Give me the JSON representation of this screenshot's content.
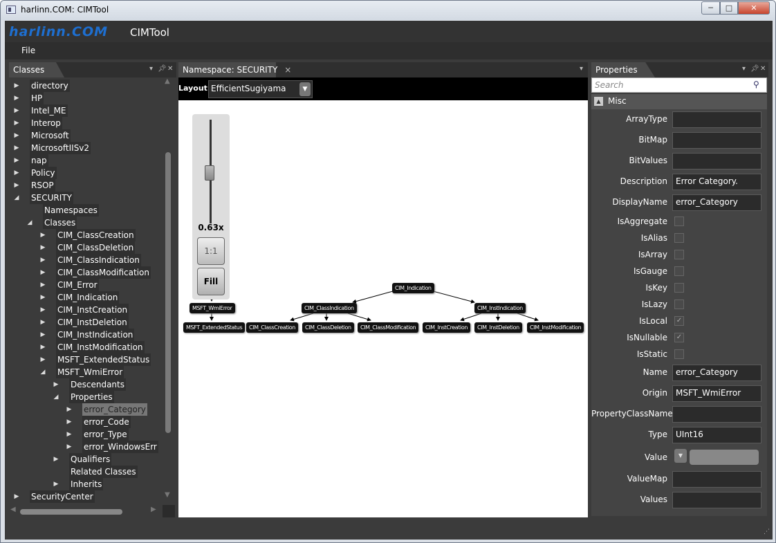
{
  "window": {
    "title": "harlinn.COM: CIMTool",
    "minimize": "─",
    "maximize": "□",
    "close": "✕"
  },
  "app": {
    "logo": "harlinn.COM",
    "title": "CIMTool"
  },
  "menu": {
    "file": "File"
  },
  "classes_panel": {
    "tab": "Classes",
    "tree": [
      {
        "label": "directory",
        "level": 1,
        "arrow": "right"
      },
      {
        "label": "HP",
        "level": 1,
        "arrow": "right"
      },
      {
        "label": "Intel_ME",
        "level": 1,
        "arrow": "right"
      },
      {
        "label": "Interop",
        "level": 1,
        "arrow": "right"
      },
      {
        "label": "Microsoft",
        "level": 1,
        "arrow": "right"
      },
      {
        "label": "MicrosoftIISv2",
        "level": 1,
        "arrow": "right"
      },
      {
        "label": "nap",
        "level": 1,
        "arrow": "right"
      },
      {
        "label": "Policy",
        "level": 1,
        "arrow": "right"
      },
      {
        "label": "RSOP",
        "level": 1,
        "arrow": "right"
      },
      {
        "label": "SECURITY",
        "level": 1,
        "arrow": "down"
      },
      {
        "label": "Namespaces",
        "level": 2,
        "arrow": ""
      },
      {
        "label": "Classes",
        "level": 2,
        "arrow": "down"
      },
      {
        "label": "CIM_ClassCreation",
        "level": 3,
        "arrow": "right"
      },
      {
        "label": "CIM_ClassDeletion",
        "level": 3,
        "arrow": "right"
      },
      {
        "label": "CIM_ClassIndication",
        "level": 3,
        "arrow": "right"
      },
      {
        "label": "CIM_ClassModification",
        "level": 3,
        "arrow": "right"
      },
      {
        "label": "CIM_Error",
        "level": 3,
        "arrow": "right"
      },
      {
        "label": "CIM_Indication",
        "level": 3,
        "arrow": "right"
      },
      {
        "label": "CIM_InstCreation",
        "level": 3,
        "arrow": "right"
      },
      {
        "label": "CIM_InstDeletion",
        "level": 3,
        "arrow": "right"
      },
      {
        "label": "CIM_InstIndication",
        "level": 3,
        "arrow": "right"
      },
      {
        "label": "CIM_InstModification",
        "level": 3,
        "arrow": "right"
      },
      {
        "label": "MSFT_ExtendedStatus",
        "level": 3,
        "arrow": "right"
      },
      {
        "label": "MSFT_WmiError",
        "level": 3,
        "arrow": "down"
      },
      {
        "label": "Descendants",
        "level": 4,
        "arrow": "right"
      },
      {
        "label": "Properties",
        "level": 4,
        "arrow": "down"
      },
      {
        "label": "error_Category",
        "level": 5,
        "arrow": "right",
        "selected": true
      },
      {
        "label": "error_Code",
        "level": 5,
        "arrow": "right"
      },
      {
        "label": "error_Type",
        "level": 5,
        "arrow": "right"
      },
      {
        "label": "error_WindowsErr",
        "level": 5,
        "arrow": "right"
      },
      {
        "label": "Qualifiers",
        "level": 4,
        "arrow": "right"
      },
      {
        "label": "Related Classes",
        "level": 4,
        "arrow": ""
      },
      {
        "label": "Inherits",
        "level": 4,
        "arrow": "right"
      },
      {
        "label": "SecurityCenter",
        "level": 1,
        "arrow": "right"
      }
    ]
  },
  "namespace_panel": {
    "tab": "Namespace: SECURITY",
    "tab_close": "×",
    "layout_label": "Layout",
    "layout_value": "EfficientSugiyama",
    "zoom_value": "0.63x",
    "zoom_level": 0.63,
    "zoom_1to1": "1:1",
    "zoom_fill": "Fill",
    "graph_nodes": {
      "msft_wmierror": "MSFT_WmiError",
      "msft_extendedstatus": "MSFT_ExtendedStatus",
      "cim_indication": "CIM_Indication",
      "cim_classindication": "CIM_ClassIndication",
      "cim_instindication": "CIM_InstIndication",
      "cim_classcreation": "CIM_ClassCreation",
      "cim_classdeletion": "CIM_ClassDeletion",
      "cim_classmodification": "CIM_ClassModification",
      "cim_instcreation": "CIM_InstCreation",
      "cim_instdeletion": "CIM_InstDeletion",
      "cim_instmodification": "CIM_InstModification"
    }
  },
  "properties_panel": {
    "tab": "Properties",
    "search_placeholder": "Search",
    "category": "Misc",
    "rows": [
      {
        "name": "ArrayType",
        "kind": "text",
        "value": ""
      },
      {
        "name": "BitMap",
        "kind": "text",
        "value": ""
      },
      {
        "name": "BitValues",
        "kind": "text",
        "value": ""
      },
      {
        "name": "Description",
        "kind": "text",
        "value": "Error Category."
      },
      {
        "name": "DisplayName",
        "kind": "text",
        "value": "error_Category"
      },
      {
        "name": "IsAggregate",
        "kind": "check",
        "checked": false
      },
      {
        "name": "IsAlias",
        "kind": "check",
        "checked": false
      },
      {
        "name": "IsArray",
        "kind": "check",
        "checked": false
      },
      {
        "name": "IsGauge",
        "kind": "check",
        "checked": false
      },
      {
        "name": "IsKey",
        "kind": "check",
        "checked": false
      },
      {
        "name": "IsLazy",
        "kind": "check",
        "checked": false
      },
      {
        "name": "IsLocal",
        "kind": "check",
        "checked": true
      },
      {
        "name": "IsNullable",
        "kind": "check",
        "checked": true
      },
      {
        "name": "IsStatic",
        "kind": "check",
        "checked": false
      },
      {
        "name": "Name",
        "kind": "text",
        "value": "error_Category"
      },
      {
        "name": "Origin",
        "kind": "text",
        "value": "MSFT_WmiError"
      },
      {
        "name": "PropertyClassName",
        "kind": "text",
        "value": ""
      },
      {
        "name": "Type",
        "kind": "text",
        "value": "UInt16"
      },
      {
        "name": "Value",
        "kind": "dropdown",
        "value": ""
      },
      {
        "name": "ValueMap",
        "kind": "text",
        "value": ""
      },
      {
        "name": "Values",
        "kind": "text",
        "value": ""
      }
    ]
  },
  "colors": {
    "accent": "#1e6fd0",
    "panel": "#3b3b3b",
    "selection": "#777777"
  }
}
